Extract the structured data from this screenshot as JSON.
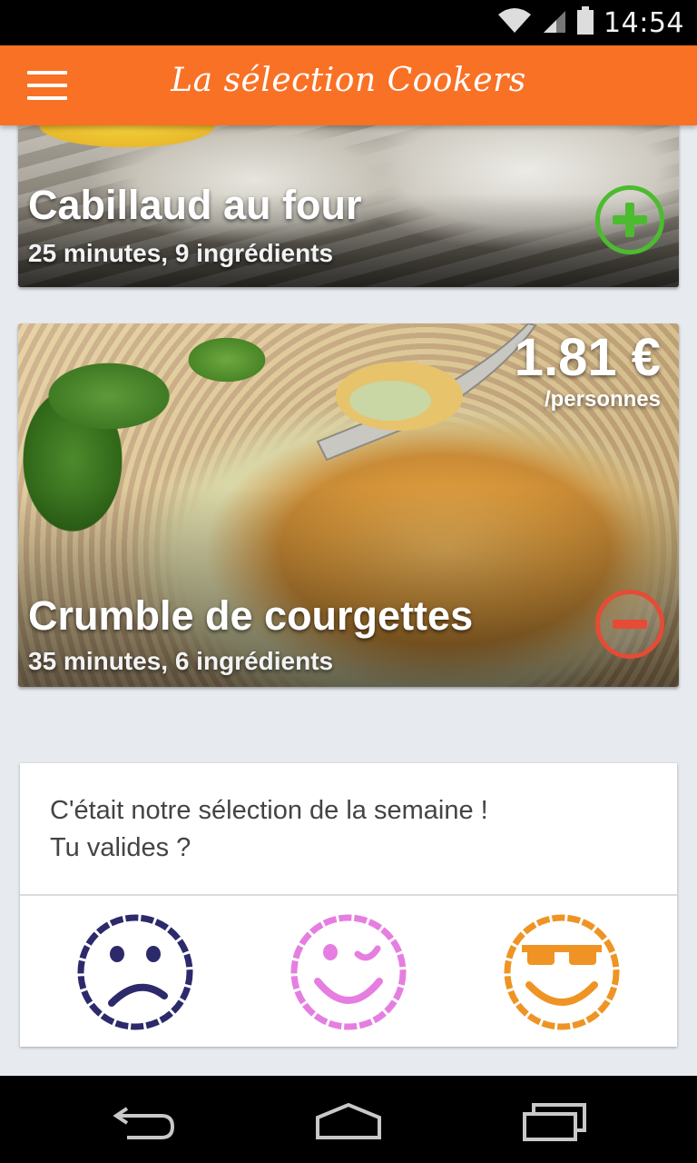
{
  "status_bar": {
    "time": "14:54"
  },
  "app_bar": {
    "title": "La sélection Cookers"
  },
  "recipes": [
    {
      "title": "Cabillaud au four",
      "meta": "25 minutes, 9 ingrédients",
      "action": "add"
    },
    {
      "title": "Crumble de courgettes",
      "meta": "35 minutes, 6 ingrédients",
      "price": "1.81 €",
      "price_unit": "/personnes",
      "action": "remove"
    }
  ],
  "feedback": {
    "line1": "C'était notre sélection de la semaine !",
    "line2": "Tu valides ?",
    "options": [
      {
        "icon": "sad-face-icon",
        "color": "#2c2a6b"
      },
      {
        "icon": "wink-face-icon",
        "color": "#e57ee0"
      },
      {
        "icon": "sunglasses-face-icon",
        "color": "#ef9424"
      }
    ]
  },
  "colors": {
    "app_bar": "#f97125",
    "add": "#4dbb2f",
    "remove": "#e54b36",
    "background": "#e7eaef"
  }
}
